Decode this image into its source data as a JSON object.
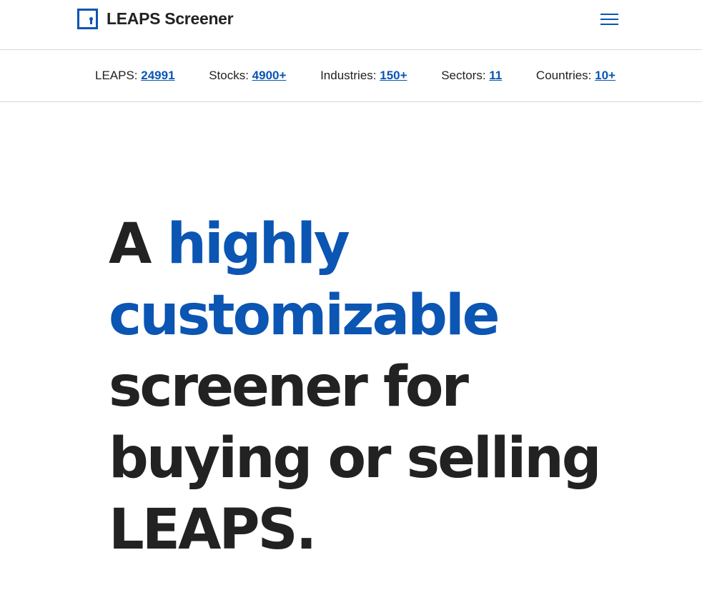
{
  "header": {
    "logo_text": "LEAPS Screener",
    "logo_icon": "keyhole-door-icon",
    "menu_icon": "hamburger-menu-icon"
  },
  "stats": [
    {
      "label": "LEAPS: ",
      "value": "24991"
    },
    {
      "label": "Stocks: ",
      "value": "4900+"
    },
    {
      "label": "Industries: ",
      "value": "150+"
    },
    {
      "label": "Sectors: ",
      "value": "11"
    },
    {
      "label": "Countries: ",
      "value": "10+"
    }
  ],
  "hero": {
    "part1": "A ",
    "part2_accent": "highly customizable",
    "part3": " screener for buying or selling LEAPS."
  },
  "colors": {
    "accent": "#0b55b3",
    "text": "#222222",
    "divider": "#d6d6d6",
    "background": "#ffffff"
  }
}
